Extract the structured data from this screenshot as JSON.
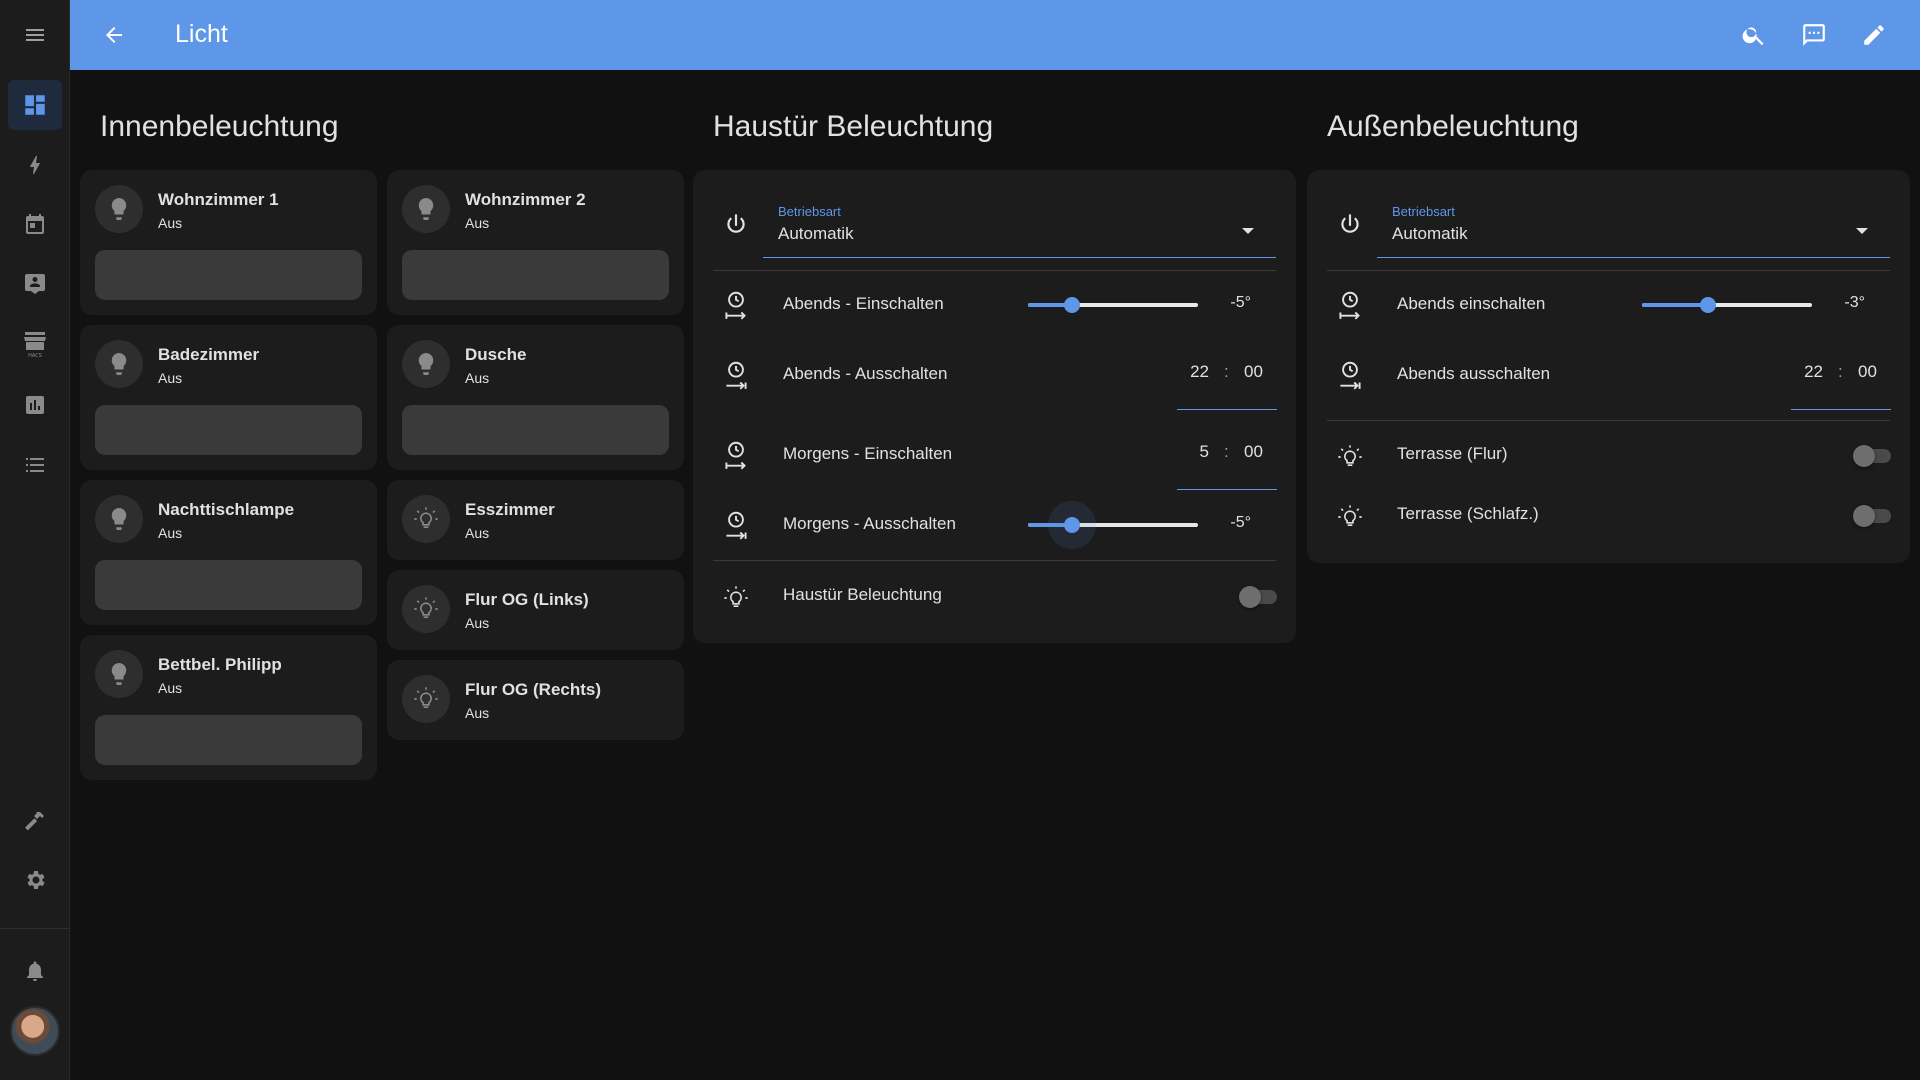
{
  "header": {
    "title": "Licht"
  },
  "sidebar": {
    "items": [
      {
        "icon": "dashboard-icon"
      },
      {
        "icon": "lightning-icon"
      },
      {
        "icon": "calendar-icon"
      },
      {
        "icon": "account-box-icon"
      },
      {
        "icon": "hacs-store-icon",
        "label": "HACS"
      },
      {
        "icon": "chart-icon"
      },
      {
        "icon": "list-icon"
      },
      {
        "icon": "hammer-icon"
      },
      {
        "icon": "gear-icon"
      },
      {
        "icon": "bell-icon"
      }
    ]
  },
  "columns": {
    "inner": {
      "title": "Innenbeleuchtung",
      "lights": [
        {
          "name": "Wohnzimmer 1",
          "state": "Aus"
        },
        {
          "name": "Wohnzimmer 2",
          "state": "Aus"
        },
        {
          "name": "Badezimmer",
          "state": "Aus"
        },
        {
          "name": "Dusche",
          "state": "Aus"
        },
        {
          "name": "Nachttischlampe",
          "state": "Aus"
        },
        {
          "name": "Esszimmer",
          "state": "Aus"
        },
        {
          "name": "Flur OG (Links)",
          "state": "Aus"
        },
        {
          "name": "Bettbel. Philipp",
          "state": "Aus"
        },
        {
          "name": "Flur OG (Rechts)",
          "state": "Aus"
        }
      ]
    },
    "door": {
      "title": "Haustür Beleuchtung",
      "select_label": "Betriebsart",
      "select_value": "Automatik",
      "rows": [
        {
          "label": "Abends - Einschalten",
          "value": "-5°",
          "level": 0.26
        },
        {
          "label": "Abends - Ausschalten",
          "hour": "22",
          "sep": ":",
          "minute": "00"
        },
        {
          "label": "Morgens - Einschalten",
          "hour": "5",
          "sep": ":",
          "minute": "00"
        },
        {
          "label": "Morgens - Ausschalten",
          "value": "-5°",
          "level": 0.26
        }
      ],
      "toggle_label": "Haustür Beleuchtung",
      "toggle_on": false
    },
    "outer": {
      "title": "Außenbeleuchtung",
      "select_label": "Betriebsart",
      "select_value": "Automatik",
      "rows": [
        {
          "label": "Abends einschalten",
          "value": "-3°",
          "level": 0.39
        },
        {
          "label": "Abends ausschalten",
          "hour": "22",
          "sep": ":",
          "minute": "00"
        }
      ],
      "toggles": [
        {
          "label": "Terrasse (Flur)",
          "on": false
        },
        {
          "label": "Terrasse (Schlafz.)",
          "on": false
        }
      ]
    }
  },
  "colors": {
    "accent": "#5e96e8",
    "background": "#111111",
    "card": "#1c1c1c",
    "sidebar": "#1c1c1c"
  }
}
